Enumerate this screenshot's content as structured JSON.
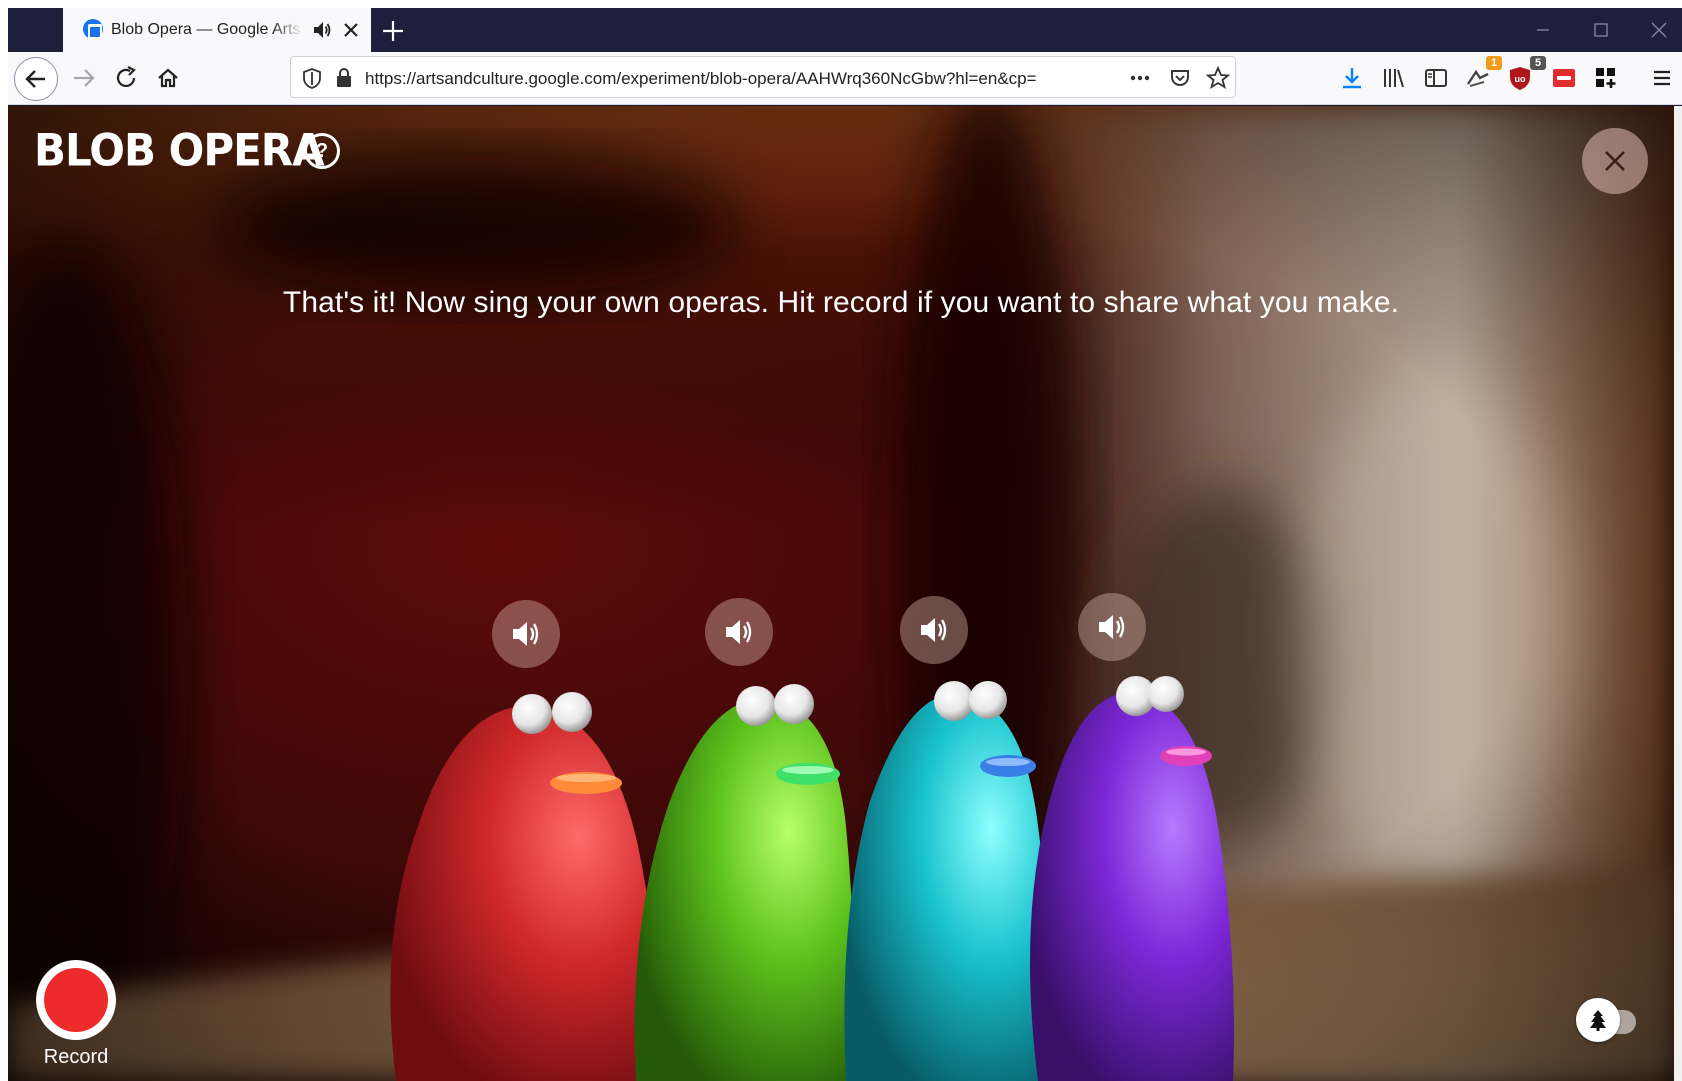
{
  "browser": {
    "tab": {
      "title": "Blob Opera — Google Arts & Culture",
      "favicon": "google-arts-culture-icon",
      "audio_icon": "speaker-icon",
      "close_icon": "close-icon"
    },
    "new_tab_icon": "plus-icon",
    "window_controls": [
      "minimize-icon",
      "maximize-icon",
      "close-icon"
    ],
    "toolbar": {
      "back_icon": "back-arrow-icon",
      "forward_icon": "forward-arrow-icon",
      "reload_icon": "reload-icon",
      "home_icon": "home-icon",
      "url": "https://artsandculture.google.com/experiment/blob-opera/AAHWrq360NcGbw?hl=en&cp=",
      "url_icons": [
        "tracking-shield-icon",
        "lock-icon",
        "more-actions-icon",
        "pocket-icon",
        "bookmark-star-icon"
      ],
      "right_icons": [
        "download-icon",
        "library-icon",
        "sidebar-icon",
        "extension-icon",
        "ublock-icon",
        "extension-red-icon",
        "extension-grid-icon",
        "menu-icon"
      ],
      "badges": {
        "extension": "1",
        "ublock": "5"
      }
    }
  },
  "page": {
    "logo": "BLOB OPERA",
    "help_label": "?",
    "instruction": "That's it! Now sing your own operas. Hit record if you want to share what you make.",
    "record_label": "Record",
    "speaker_icon": "speaker-icon",
    "toggle_icon": "tree-icon",
    "blobs": [
      {
        "name": "red-blob",
        "color": "#d0282a",
        "lip": "#ff8a3a"
      },
      {
        "name": "green-blob",
        "color": "#5cc21c",
        "lip": "#3ee06a"
      },
      {
        "name": "cyan-blob",
        "color": "#18c2cc",
        "lip": "#3a7ee8"
      },
      {
        "name": "purple-blob",
        "color": "#7d28d8",
        "lip": "#e040b8"
      }
    ]
  },
  "colors": {
    "tabstrip": "#1f1e3d",
    "record": "#ee2b2b",
    "stage_dark": "#3a1408",
    "stage_light": "#b9a898"
  }
}
